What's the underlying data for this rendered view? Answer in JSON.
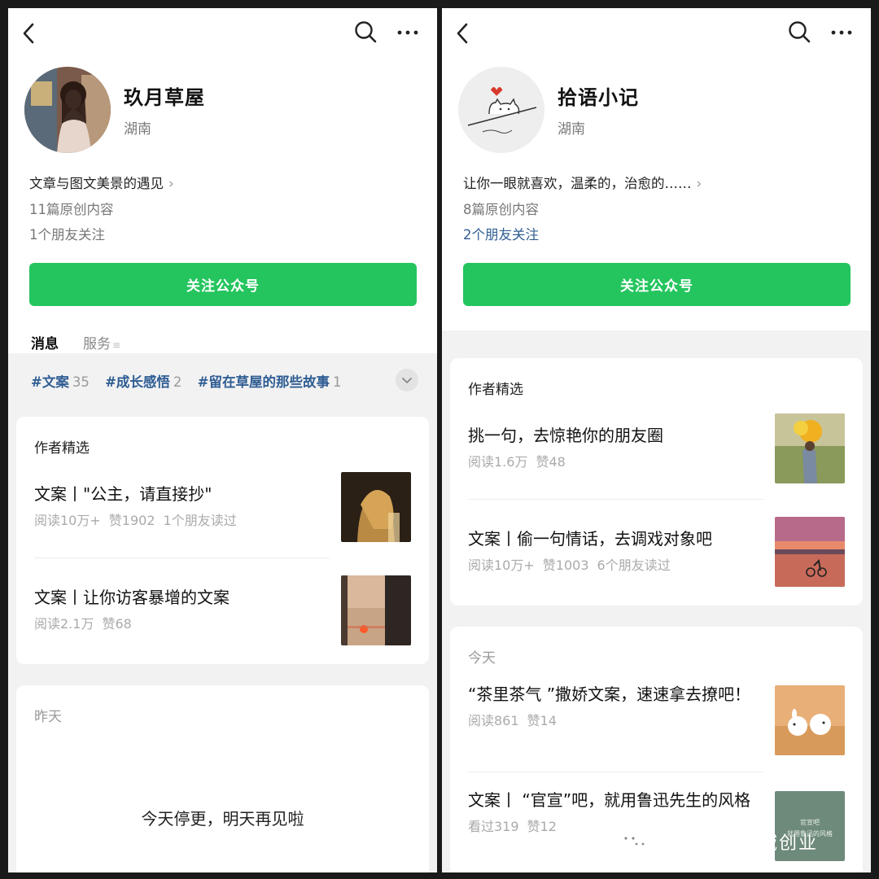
{
  "left": {
    "account_name": "玖月草屋",
    "region": "湖南",
    "intro": "文章与图文美景的遇见",
    "original_count": "11篇原创内容",
    "friends_follow": "1个朋友关注",
    "follow_button": "关注公众号",
    "tabs": {
      "messages": "消息",
      "services": "服务",
      "services_marker": "≡"
    },
    "tags": [
      {
        "name": "#文案",
        "count": "35"
      },
      {
        "name": "#成长感悟",
        "count": "2"
      },
      {
        "name": "#留在草屋的那些故事",
        "count": "1"
      }
    ],
    "picks_heading": "作者精选",
    "picks": [
      {
        "title": "文案丨\"公主，请直接抄\"",
        "reads": "阅读10万+",
        "likes": "赞1902",
        "friends": "1个朋友读过"
      },
      {
        "title": "文案丨让你访客暴增的文案",
        "reads": "阅读2.1万",
        "likes": "赞68"
      }
    ],
    "date_heading": "昨天",
    "notice": "今天停更，明天再见啦"
  },
  "right": {
    "account_name": "拾语小记",
    "region": "湖南",
    "intro": "让你一眼就喜欢，温柔的，治愈的……",
    "original_count": "8篇原创内容",
    "friends_follow": "2个朋友关注",
    "follow_button": "关注公众号",
    "picks_heading": "作者精选",
    "picks": [
      {
        "title": "挑一句，去惊艳你的朋友圈",
        "reads": "阅读1.6万",
        "likes": "赞48"
      },
      {
        "title": "文案丨偷一句情话，去调戏对象吧",
        "reads": "阅读10万+",
        "likes": "赞1003",
        "friends": "6个朋友读过"
      }
    ],
    "date_heading": "今天",
    "articles": [
      {
        "title": "“茶里茶气 ”撒娇文案，速速拿去撩吧！",
        "reads": "阅读861",
        "likes": "赞14"
      },
      {
        "title": "文案丨 “官宣”吧，就用鲁迅先生的风格",
        "reads": "看过319",
        "likes": "赞12",
        "thumb_text": [
          "官宣吧",
          "就用鲁迅的风格"
        ]
      }
    ]
  },
  "watermark": "公众号 · 私域创业",
  "colors": {
    "accent_green": "#24c55e",
    "link_blue": "#2f5d93",
    "bg_gray": "#f2f2f2"
  },
  "icons": [
    "back-arrow-icon",
    "search-icon",
    "more-dots-icon",
    "chevron-right-icon",
    "chevron-down-icon",
    "wechat-logo-icon"
  ]
}
